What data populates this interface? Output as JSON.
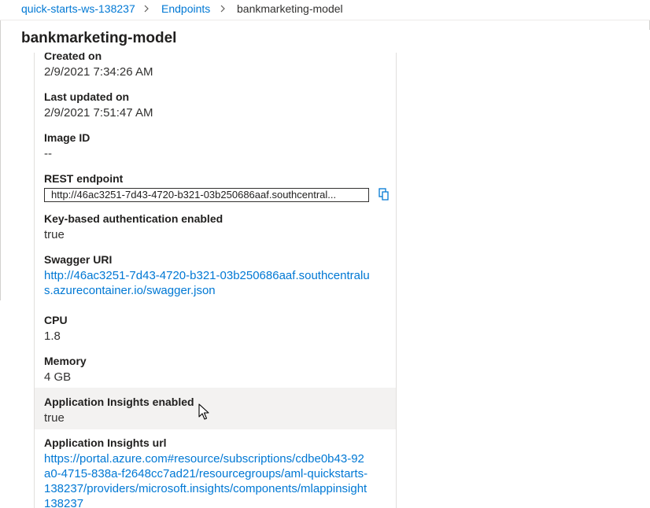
{
  "breadcrumb": {
    "items": [
      "quick-starts-ws-138237",
      "Endpoints",
      "bankmarketing-model"
    ]
  },
  "page": {
    "title": "bankmarketing-model"
  },
  "details": {
    "created_on": {
      "label": "Created on",
      "value": "2/9/2021 7:34:26 AM"
    },
    "last_updated_on": {
      "label": "Last updated on",
      "value": "2/9/2021 7:51:47 AM"
    },
    "image_id": {
      "label": "Image ID",
      "value": "--"
    },
    "rest_endpoint": {
      "label": "REST endpoint",
      "value": "http://46ac3251-7d43-4720-b321-03b250686aaf.southcentral..."
    },
    "key_auth": {
      "label": "Key-based authentication enabled",
      "value": "true"
    },
    "swagger_uri": {
      "label": "Swagger URI",
      "value": "http://46ac3251-7d43-4720-b321-03b250686aaf.southcentralus.azurecontainer.io/swagger.json"
    },
    "cpu": {
      "label": "CPU",
      "value": "1.8"
    },
    "memory": {
      "label": "Memory",
      "value": "4 GB"
    },
    "app_insights_enabled": {
      "label": "Application Insights enabled",
      "value": "true"
    },
    "app_insights_url": {
      "label": "Application Insights url",
      "value": "https://portal.azure.com#resource/subscriptions/cdbe0b43-92a0-4715-838a-f2648cc7ad21/resourcegroups/aml-quickstarts-138237/providers/microsoft.insights/components/mlappinsight138237"
    }
  },
  "icons": {
    "copy": "copy-icon",
    "chevron": "chevron-right-icon",
    "cursor": "mouse-pointer-icon"
  },
  "colors": {
    "link": "#0078d4",
    "text": "#201f1e",
    "hover_row": "#f3f2f1"
  }
}
